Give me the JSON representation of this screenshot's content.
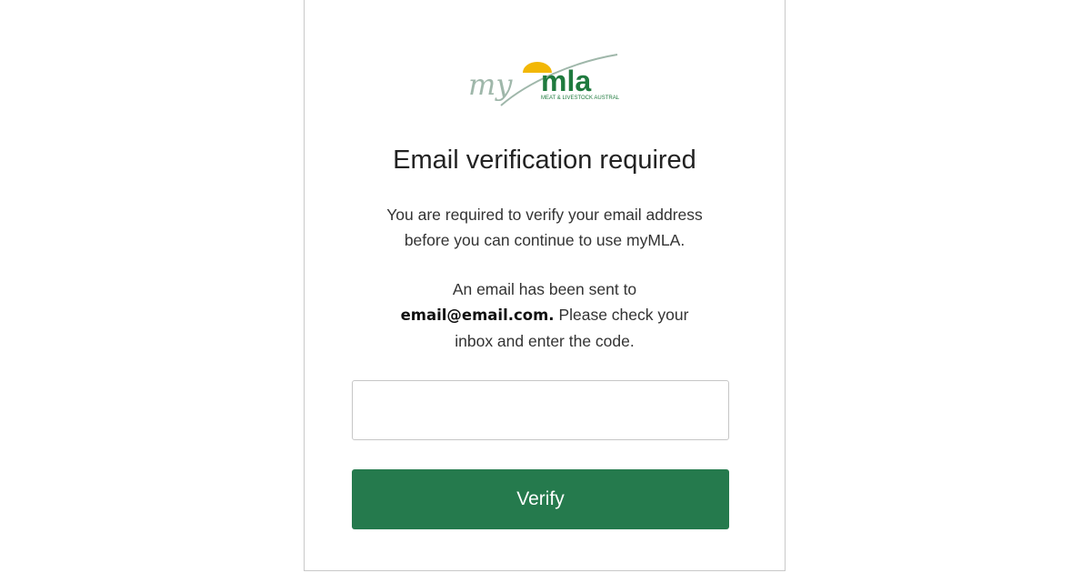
{
  "logo": {
    "brand_prefix": "my",
    "brand_name": "mla",
    "tagline": "MEAT & LIVESTOCK AUSTRALIA"
  },
  "heading": "Email verification required",
  "intro": {
    "line1": "You are required to verify your email address",
    "line2": "before you can continue to use myMLA."
  },
  "notice": {
    "line1": "An email has been sent to",
    "email": "email@email.com.",
    "line2_rest": " Please check your",
    "line3": "inbox and enter the code."
  },
  "code_input": {
    "value": "",
    "placeholder": ""
  },
  "verify_button": {
    "label": "Verify"
  },
  "colors": {
    "accent_green": "#257a4d",
    "logo_green": "#1f7a3e",
    "logo_sun": "#f2b705",
    "logo_script": "#9fb7aa"
  }
}
